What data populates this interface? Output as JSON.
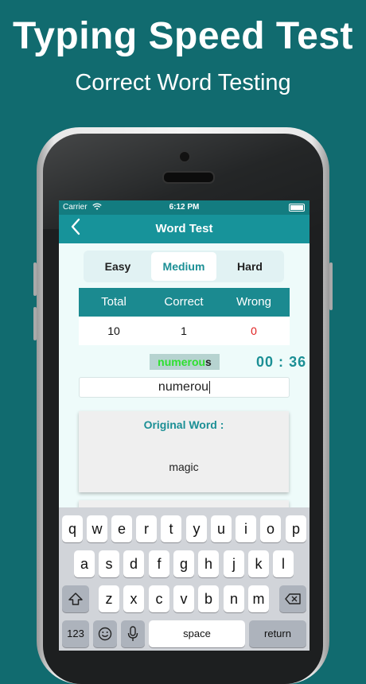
{
  "hero": {
    "title": "Typing Speed Test",
    "subtitle": "Correct Word Testing"
  },
  "statusbar": {
    "carrier": "Carrier",
    "time": "6:12 PM"
  },
  "navbar": {
    "back_icon": "chevron-left-icon",
    "title": "Word Test"
  },
  "difficulty": {
    "options": [
      "Easy",
      "Medium",
      "Hard"
    ],
    "selected": "Medium"
  },
  "score": {
    "headers": [
      "Total",
      "Correct",
      "Wrong"
    ],
    "values": [
      "10",
      "1",
      "0"
    ]
  },
  "current_word": {
    "typed": "numerou",
    "remaining": "s"
  },
  "timer": {
    "minutes": "00",
    "separator": ":",
    "seconds": "36"
  },
  "input": {
    "value": "numerou"
  },
  "original_card": {
    "title": "Original Word :",
    "word": "magic"
  },
  "keyboard": {
    "row1": [
      "q",
      "w",
      "e",
      "r",
      "t",
      "y",
      "u",
      "i",
      "o",
      "p"
    ],
    "row2": [
      "a",
      "s",
      "d",
      "f",
      "g",
      "h",
      "j",
      "k",
      "l"
    ],
    "row3": [
      "z",
      "x",
      "c",
      "v",
      "b",
      "n",
      "m"
    ],
    "shift_icon": "shift-icon",
    "delete_icon": "backspace-icon",
    "numbers_label": "123",
    "emoji_icon": "emoji-icon",
    "mic_icon": "microphone-icon",
    "space_label": "space",
    "return_label": "return"
  },
  "colors": {
    "background": "#116b6f",
    "nav": "#17939a",
    "accent": "#1b8f95",
    "typed_green": "#2ee02e",
    "wrong_red": "#e01f1f"
  }
}
